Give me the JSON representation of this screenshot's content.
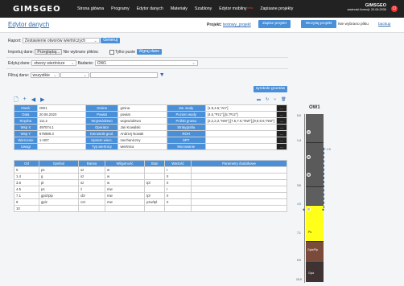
{
  "header": {
    "logo": "GIMSGEO",
    "nav": [
      "Strona główna",
      "Programy",
      "Edytor danych",
      "Materiały",
      "Szablony",
      "Edytor mobilny",
      "Zapisane projekty"
    ],
    "beta": "beta",
    "brand": "GIMSGEO",
    "license": "ważność licencji: 20.06.2030",
    "power_icon": "power-icon"
  },
  "page": {
    "title": "Edytor danych",
    "project_label": "Projekt:",
    "project_name": "testowy_projekt",
    "save_label": "Zapisz projekt",
    "load_label": "Wczytaj projekt",
    "no_file": "Nie wybrano pliku",
    "backup": "backup"
  },
  "form": {
    "report_label": "Raport:",
    "report_value": "Zestawienie otworów wiertniczych",
    "generate": "Generuj",
    "import_label": "Importuj dane:",
    "browse": "Przeglądaj...",
    "no_files": "Nie wybrano plików.",
    "only_empty": "Tylko puste",
    "load_data": "Wgraj dane",
    "edit_label": "Edytuj dane:",
    "edit_value": "otwory wiertnicze",
    "study_label": "Badanie:",
    "study_value": "OW1",
    "filter_label": "Filtruj dane:",
    "filter_value": "wszystkie",
    "soil_symbols": "symbole gruntów"
  },
  "info": {
    "rows": [
      [
        "Otwór",
        "OW1",
        "Gmina",
        "gmina",
        "Zw. wody",
        "[1.9,4.5,\"zm\"]"
      ],
      [
        "Data",
        "20.06.2020",
        "Powiat",
        "powiat",
        "Poziom wody",
        "[4.5,\"Pz1\"],[5,\"Pz2\"]"
      ],
      [
        "Rzędna",
        "111.2",
        "Województwo",
        "województwo",
        "Próbki gruntu",
        "[2,2,2,2,\"NW\"],[7.5,7.6,\"NW\"],[9,9,9.6,\"NW\"]"
      ],
      [
        "Wsp X",
        "497074.1",
        "Operator",
        "Jan Kowalski",
        "Stratygrafia",
        ""
      ],
      [
        "Wsp Y",
        "675989.3",
        "Kierownik geol.",
        "Andrzej Nowak",
        "ROH",
        ""
      ],
      [
        "Wiercenie",
        "1÷007",
        "System wierc.",
        "mechaniczny",
        "SPT",
        ""
      ],
      [
        "Uwagi",
        "",
        "Typ wiertnicy",
        "wiertnica",
        "Mocowanie",
        ""
      ]
    ]
  },
  "layers": {
    "headers": [
      "Od",
      "Symbol",
      "Barwa",
      "Wilgotność",
      "Stan",
      "Wartość",
      "Parametry dodatkowe"
    ],
    "rows": [
      [
        "0",
        "ps",
        "sz",
        "w",
        "",
        "I",
        ""
      ],
      [
        "1.4",
        "g",
        "sz",
        "w",
        "",
        "II",
        ""
      ],
      [
        "3.6",
        "pl",
        "sz",
        "w",
        "tpl",
        "II",
        ""
      ],
      [
        "4.5",
        "ps",
        "ż",
        "mw",
        "",
        "I",
        ""
      ],
      [
        "7.1",
        "gpiz/pip",
        "cbr",
        "mw",
        "tpl",
        "II",
        ""
      ],
      [
        "9",
        "gpiz",
        "czz",
        "mw",
        "pzw/tpl",
        "II",
        ""
      ],
      [
        "10",
        "",
        "",
        "",
        "",
        "",
        ""
      ]
    ]
  },
  "borehole": {
    "title": "OW1",
    "depths": [
      "0.0",
      "1.4",
      "3.6",
      "4.5",
      "7.1",
      "9.0",
      "10.0"
    ],
    "labels": [
      "Ps",
      "Gpiz/Pip",
      "Gpiz"
    ],
    "water": "4.5"
  },
  "colors": {
    "accent": "#4a90d9",
    "dark": "#222222",
    "sand": "#ffff1a",
    "clay": "#7a4a3a",
    "gray": "#5e5e5e"
  }
}
